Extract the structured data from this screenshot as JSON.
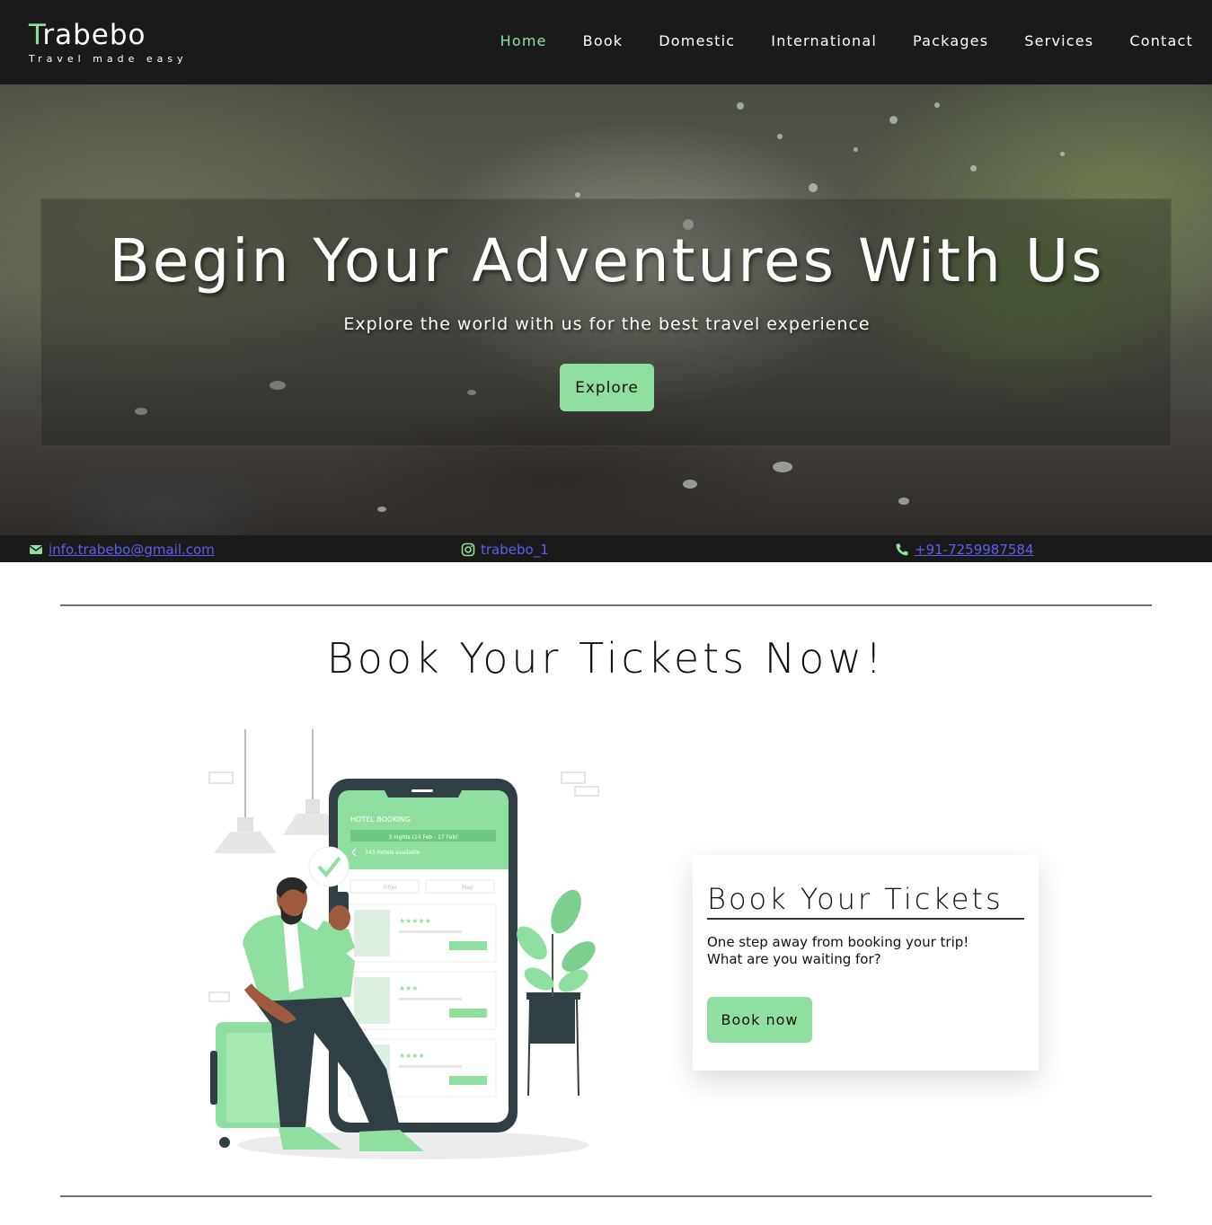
{
  "brand": {
    "name_first": "T",
    "name_rest": "rabebo",
    "tagline": "Travel made easy",
    "accent_color": "#8fe0a0"
  },
  "nav": {
    "items": [
      {
        "label": "Home",
        "active": true
      },
      {
        "label": "Book",
        "active": false
      },
      {
        "label": "Domestic",
        "active": false
      },
      {
        "label": "International",
        "active": false
      },
      {
        "label": "Packages",
        "active": false
      },
      {
        "label": "Services",
        "active": false
      },
      {
        "label": "Contact",
        "active": false
      }
    ]
  },
  "hero": {
    "title": "Begin Your Adventures With Us",
    "subtitle": "Explore the world with us for the best travel experience",
    "cta_label": "Explore"
  },
  "contact": {
    "email": "info.trabebo@gmail.com",
    "instagram": "trabebo_1",
    "phone": "+91-7259987584",
    "email_icon": "envelope-icon",
    "instagram_icon": "instagram-icon",
    "phone_icon": "phone-icon"
  },
  "booking": {
    "section_title": "Book Your Tickets Now!",
    "card_title": "Book Your Tickets",
    "card_text_line1": "One step away from booking your trip!",
    "card_text_line2": "What are you waiting for?",
    "button_label": "Book now"
  },
  "illustration": {
    "header": "HOTEL BOOKING",
    "nights": "3 nights (14 Feb - 17 Feb)",
    "hotels": "343 Hotels available",
    "filter": "Filter",
    "map": "Map"
  }
}
